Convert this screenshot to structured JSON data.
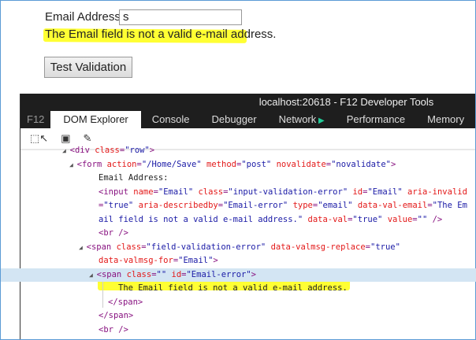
{
  "page": {
    "email_label": "Email Address:",
    "email_value": "s",
    "error_message": "The Email field is not a valid e-mail address.",
    "button_label": "Test Validation"
  },
  "devtools": {
    "title": "localhost:20618 - F12 Developer Tools",
    "tabs": [
      "F12",
      "DOM Explorer",
      "Console",
      "Debugger",
      "Network",
      "Performance",
      "Memory"
    ],
    "active_tab": "DOM Explorer",
    "toolbar": [
      {
        "icon": "select-element-icon"
      },
      {
        "icon": "highlight-box-icon"
      },
      {
        "icon": "color-picker-icon"
      }
    ],
    "lines": [
      {
        "indent": 90,
        "arrow": true,
        "tokens": [
          [
            "t",
            "<div "
          ],
          [
            "a",
            "class"
          ],
          [
            "t",
            "="
          ],
          [
            "v",
            "\"row\""
          ],
          [
            "t",
            ">"
          ]
        ]
      },
      {
        "indent": 99,
        "arrow": true,
        "tokens": [
          [
            "t",
            "<form "
          ],
          [
            "a",
            "action"
          ],
          [
            "t",
            "="
          ],
          [
            "v",
            "\"/Home/Save\""
          ],
          [
            "t",
            " "
          ],
          [
            "a",
            "method"
          ],
          [
            "t",
            "="
          ],
          [
            "v",
            "\"post\""
          ],
          [
            "t",
            " "
          ],
          [
            "a",
            "novalidate"
          ],
          [
            "t",
            "="
          ],
          [
            "v",
            "\"novalidate\""
          ],
          [
            "t",
            ">"
          ]
        ]
      },
      {
        "indent": 124,
        "arrow": false,
        "tokens": [
          [
            "x",
            "Email Address:"
          ]
        ]
      },
      {
        "indent": 124,
        "arrow": false,
        "tokens": [
          [
            "t",
            "<input "
          ],
          [
            "a",
            "name"
          ],
          [
            "t",
            "="
          ],
          [
            "v",
            "\"Email\""
          ],
          [
            "t",
            " "
          ],
          [
            "a",
            "class"
          ],
          [
            "t",
            "="
          ],
          [
            "v",
            "\"input-validation-error\""
          ],
          [
            "t",
            " "
          ],
          [
            "a",
            "id"
          ],
          [
            "t",
            "="
          ],
          [
            "v",
            "\"Email\""
          ],
          [
            "t",
            " "
          ],
          [
            "a",
            "aria-invalid"
          ]
        ]
      },
      {
        "indent": 124,
        "arrow": false,
        "tokens": [
          [
            "t",
            "="
          ],
          [
            "v",
            "\"true\""
          ],
          [
            "t",
            " "
          ],
          [
            "a",
            "aria-describedby"
          ],
          [
            "t",
            "="
          ],
          [
            "v",
            "\"Email-error\""
          ],
          [
            "t",
            " "
          ],
          [
            "a",
            "type"
          ],
          [
            "t",
            "="
          ],
          [
            "v",
            "\"email\""
          ],
          [
            "t",
            " "
          ],
          [
            "a",
            "data-val-email"
          ],
          [
            "t",
            "="
          ],
          [
            "v",
            "\"The Em"
          ]
        ]
      },
      {
        "indent": 124,
        "arrow": false,
        "tokens": [
          [
            "v",
            "ail field is not a valid e-mail address.\""
          ],
          [
            "t",
            " "
          ],
          [
            "a",
            "data-val"
          ],
          [
            "t",
            "="
          ],
          [
            "v",
            "\"true\""
          ],
          [
            "t",
            " "
          ],
          [
            "a",
            "value"
          ],
          [
            "t",
            "="
          ],
          [
            "v",
            "\"\""
          ],
          [
            "t",
            " />"
          ]
        ]
      },
      {
        "indent": 124,
        "arrow": false,
        "tokens": [
          [
            "t",
            "<br />"
          ]
        ]
      },
      {
        "indent": 111,
        "arrow": true,
        "tokens": [
          [
            "t",
            "<span "
          ],
          [
            "a",
            "class"
          ],
          [
            "t",
            "="
          ],
          [
            "v",
            "\"field-validation-error\""
          ],
          [
            "t",
            " "
          ],
          [
            "a",
            "data-valmsg-replace"
          ],
          [
            "t",
            "="
          ],
          [
            "v",
            "\"true\""
          ]
        ]
      },
      {
        "indent": 124,
        "arrow": false,
        "tokens": [
          [
            "a",
            "data-valmsg-for"
          ],
          [
            "t",
            "="
          ],
          [
            "v",
            "\"Email\""
          ],
          [
            "t",
            ">"
          ]
        ]
      },
      {
        "indent": 124,
        "arrow": true,
        "selected": true,
        "tokens": [
          [
            "t",
            "<span "
          ],
          [
            "a",
            "class"
          ],
          [
            "t",
            "="
          ],
          [
            "v",
            "\"\""
          ],
          [
            "t",
            " "
          ],
          [
            "a",
            "id"
          ],
          [
            "t",
            "="
          ],
          [
            "v",
            "\"Email-error\""
          ],
          [
            "t",
            ">"
          ]
        ]
      },
      {
        "indent": 149,
        "arrow": false,
        "tokens": [
          [
            "x",
            "The Email field is not a valid e-mail address."
          ]
        ]
      },
      {
        "indent": 136,
        "arrow": false,
        "tokens": [
          [
            "t",
            "</span>"
          ]
        ]
      },
      {
        "indent": 124,
        "arrow": false,
        "tokens": [
          [
            "t",
            "</span>"
          ]
        ]
      },
      {
        "indent": 124,
        "arrow": false,
        "tokens": [
          [
            "t",
            "<br />"
          ]
        ]
      }
    ]
  }
}
